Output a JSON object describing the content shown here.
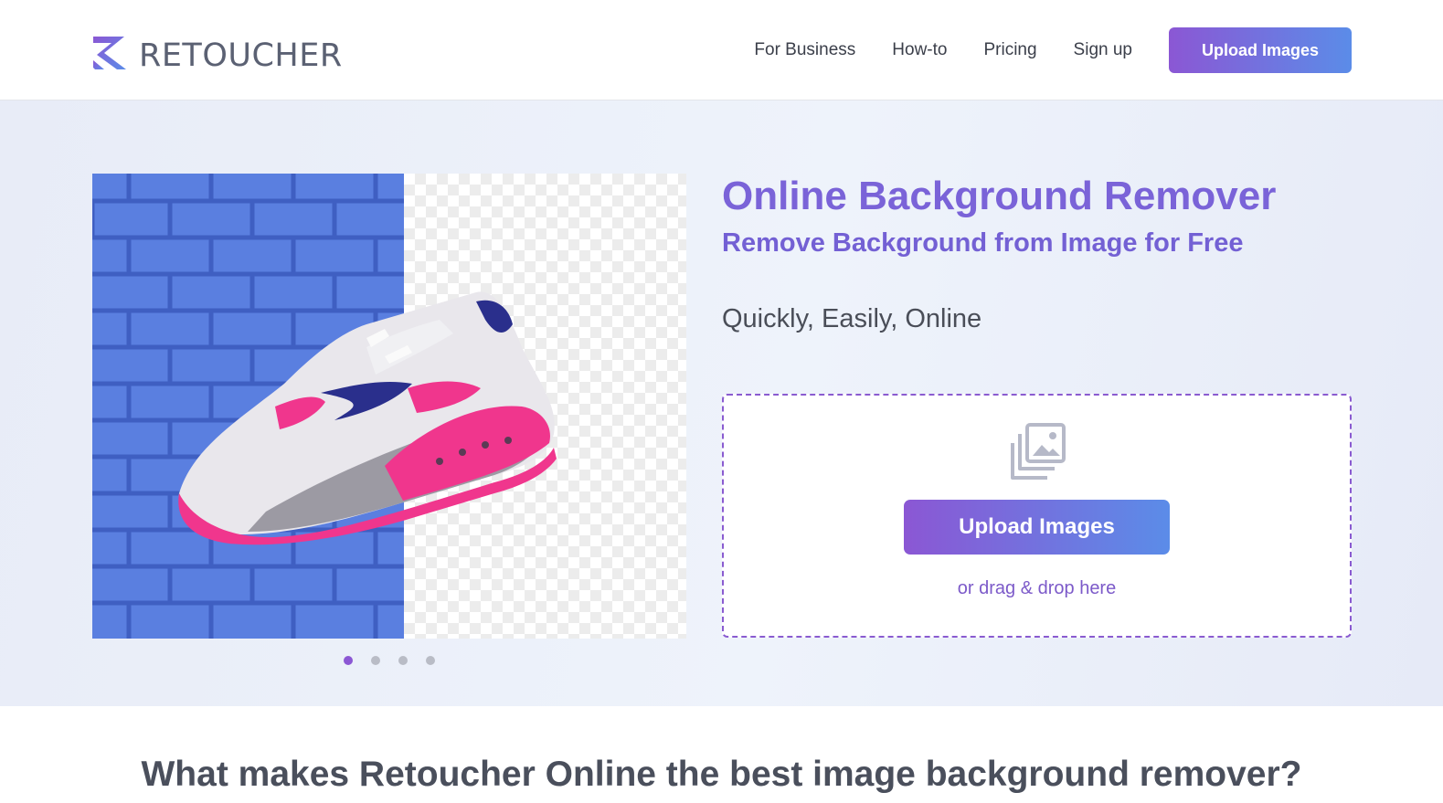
{
  "brand": {
    "name": "RETOUCHER",
    "logo_icon": "retoucher-r-logo-icon"
  },
  "nav": {
    "links": [
      "For Business",
      "How-to",
      "Pricing",
      "Sign up"
    ],
    "cta": "Upload Images"
  },
  "hero": {
    "title": "Online Background Remover",
    "subtitle": "Remove Background from Image for Free",
    "tagline": "Quickly, Easily, Online",
    "dropzone": {
      "icon": "image-gallery-icon",
      "button": "Upload Images",
      "hint": "or drag & drop here"
    },
    "carousel": {
      "slides": 4,
      "active": 1
    }
  },
  "section": {
    "heading": "What makes Retoucher Online the best image background remover?"
  },
  "colors": {
    "accent_purple": "#8b57d4",
    "accent_blue": "#5b8ce8",
    "title_purple": "#7a63d8",
    "brick_blue": "#5a7fe0"
  }
}
